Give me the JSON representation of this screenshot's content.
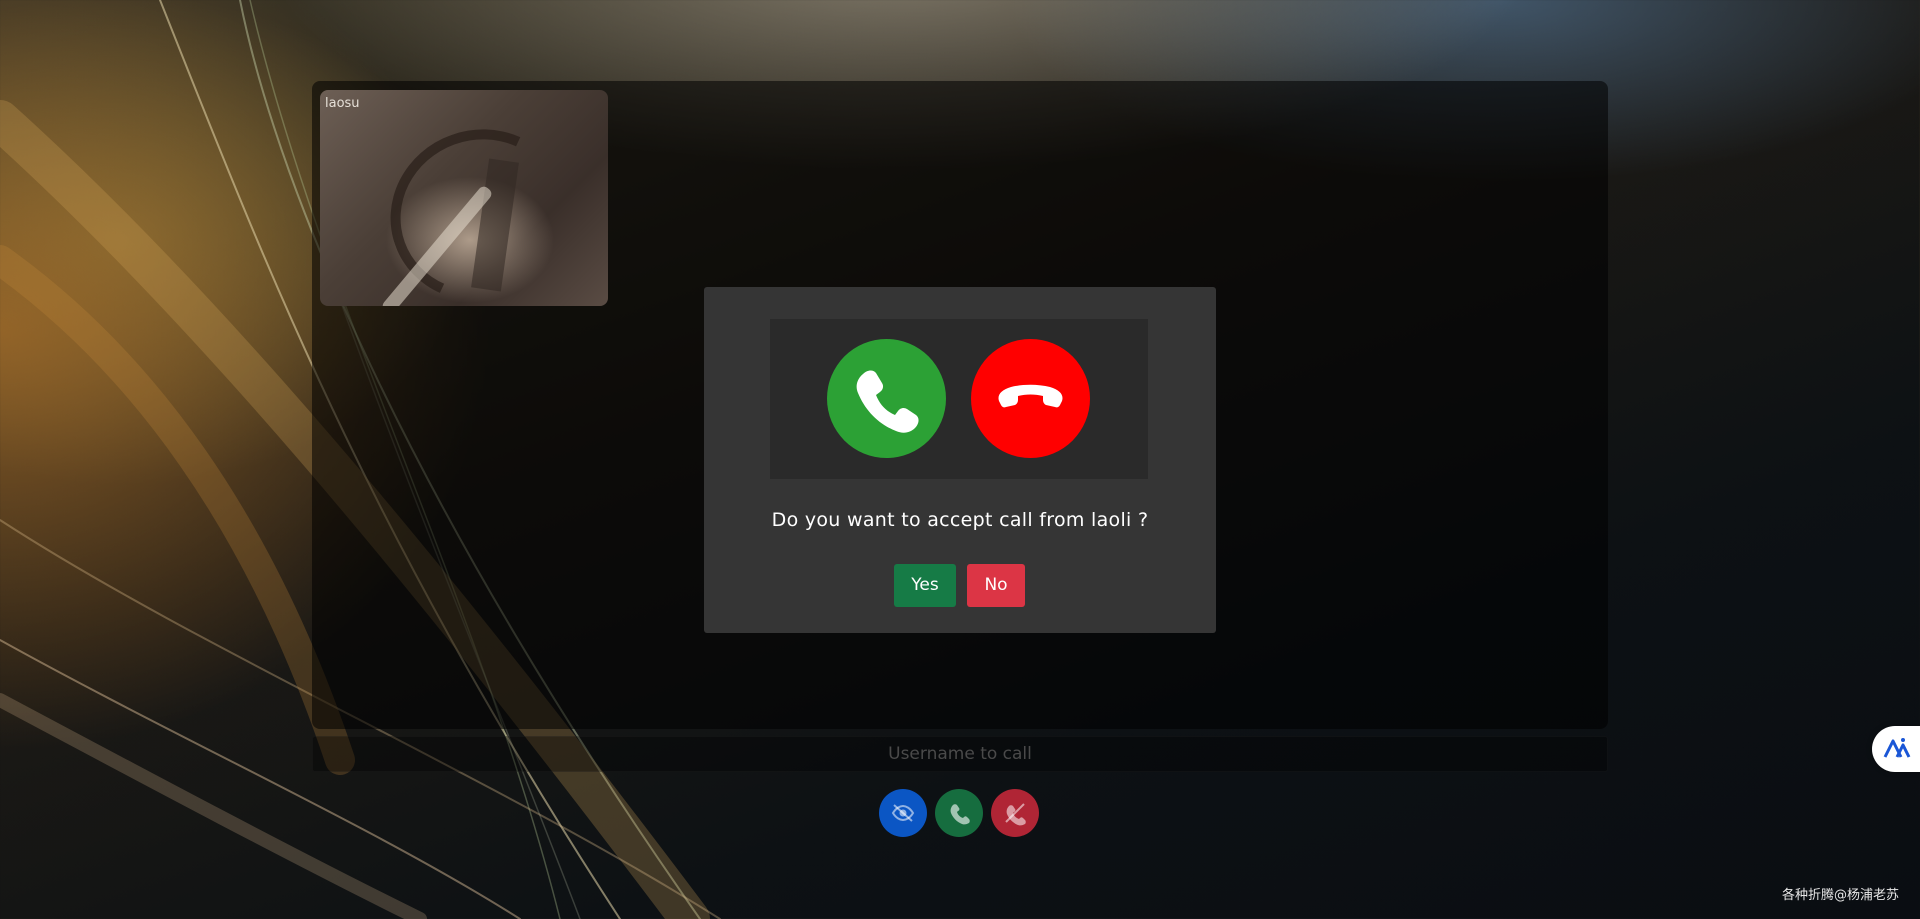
{
  "local_video": {
    "label": "laosu"
  },
  "incoming_call_dialog": {
    "accept_icon": "phone-accept-icon",
    "decline_icon": "phone-hangup-icon",
    "message": "Do you want to accept call from laoli ?",
    "yes_label": "Yes",
    "no_label": "No"
  },
  "call_input": {
    "placeholder": "Username to call",
    "value": ""
  },
  "controls": {
    "toggle_video_icon": "eye-slash-icon",
    "call_icon": "phone-icon",
    "hangup_icon": "phone-slash-icon"
  },
  "side_widget": {
    "icon": "ai-assistant-icon"
  },
  "watermark": "各种折腾@杨浦老苏",
  "colors": {
    "accept_green": "#2ca135",
    "decline_red": "#ff0000",
    "yes_button": "#167b46",
    "no_button": "#dc3545",
    "video_toggle_blue": "#0b56c4",
    "call_green": "#166d3f",
    "hangup_red": "#b02535",
    "dialog_bg": "#353535"
  }
}
